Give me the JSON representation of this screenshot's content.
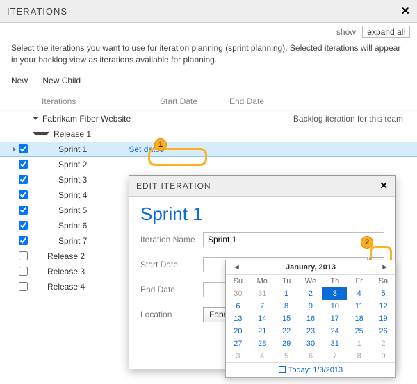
{
  "header": {
    "title": "ITERATIONS"
  },
  "toolbar": {
    "show": "show",
    "expand": "expand all"
  },
  "description": "Select the iterations you want to use for iteration planning (sprint planning). Selected iterations will appear in your backlog view as iterations available for planning.",
  "actions": {
    "new": "New",
    "new_child": "New Child"
  },
  "columns": {
    "iterations": "Iterations",
    "start": "Start Date",
    "end": "End Date"
  },
  "tree": {
    "root": {
      "label": "Fabrikam Fiber Website",
      "note": "Backlog iteration for this team"
    },
    "release1": {
      "label": "Release 1"
    },
    "sprints": [
      {
        "label": "Sprint 1",
        "checked": true,
        "selected": true,
        "link": "Set dates"
      },
      {
        "label": "Sprint 2",
        "checked": true
      },
      {
        "label": "Sprint 3",
        "checked": true
      },
      {
        "label": "Sprint 4",
        "checked": true
      },
      {
        "label": "Sprint 5",
        "checked": true
      },
      {
        "label": "Sprint 6",
        "checked": true
      },
      {
        "label": "Sprint 7",
        "checked": true
      }
    ],
    "later": [
      {
        "label": "Release 2",
        "checked": false
      },
      {
        "label": "Release 3",
        "checked": false
      },
      {
        "label": "Release 4",
        "checked": false
      }
    ]
  },
  "dialog": {
    "title": "EDIT ITERATION",
    "heading": "Sprint 1",
    "fields": {
      "name_label": "Iteration Name",
      "name_value": "Sprint 1",
      "start_label": "Start Date",
      "start_value": "",
      "end_label": "End Date",
      "end_value": "",
      "location_label": "Location",
      "location_value": "Fabrikam Fi..."
    }
  },
  "picker": {
    "month": "January, 2013",
    "weekdays": [
      "Su",
      "Mo",
      "Tu",
      "We",
      "Th",
      "Fr",
      "Sa"
    ],
    "weeks": [
      [
        {
          "d": 30,
          "o": true
        },
        {
          "d": 31,
          "o": true
        },
        {
          "d": 1
        },
        {
          "d": 2
        },
        {
          "d": 3,
          "sel": true
        },
        {
          "d": 4
        },
        {
          "d": 5
        }
      ],
      [
        {
          "d": 6
        },
        {
          "d": 7
        },
        {
          "d": 8
        },
        {
          "d": 9
        },
        {
          "d": 10
        },
        {
          "d": 11
        },
        {
          "d": 12
        }
      ],
      [
        {
          "d": 13
        },
        {
          "d": 14
        },
        {
          "d": 15
        },
        {
          "d": 16
        },
        {
          "d": 17
        },
        {
          "d": 18
        },
        {
          "d": 19
        }
      ],
      [
        {
          "d": 20
        },
        {
          "d": 21
        },
        {
          "d": 22
        },
        {
          "d": 23
        },
        {
          "d": 24
        },
        {
          "d": 25
        },
        {
          "d": 26
        }
      ],
      [
        {
          "d": 27
        },
        {
          "d": 28
        },
        {
          "d": 29
        },
        {
          "d": 30
        },
        {
          "d": 31
        },
        {
          "d": 1,
          "o": true
        },
        {
          "d": 2,
          "o": true
        }
      ],
      [
        {
          "d": 3,
          "o": true
        },
        {
          "d": 4,
          "o": true
        },
        {
          "d": 5,
          "o": true
        },
        {
          "d": 6,
          "o": true
        },
        {
          "d": 7,
          "o": true
        },
        {
          "d": 8,
          "o": true
        },
        {
          "d": 9,
          "o": true
        }
      ]
    ],
    "today": "Today: 1/3/2013"
  },
  "annotations": {
    "one": "1",
    "two": "2"
  }
}
